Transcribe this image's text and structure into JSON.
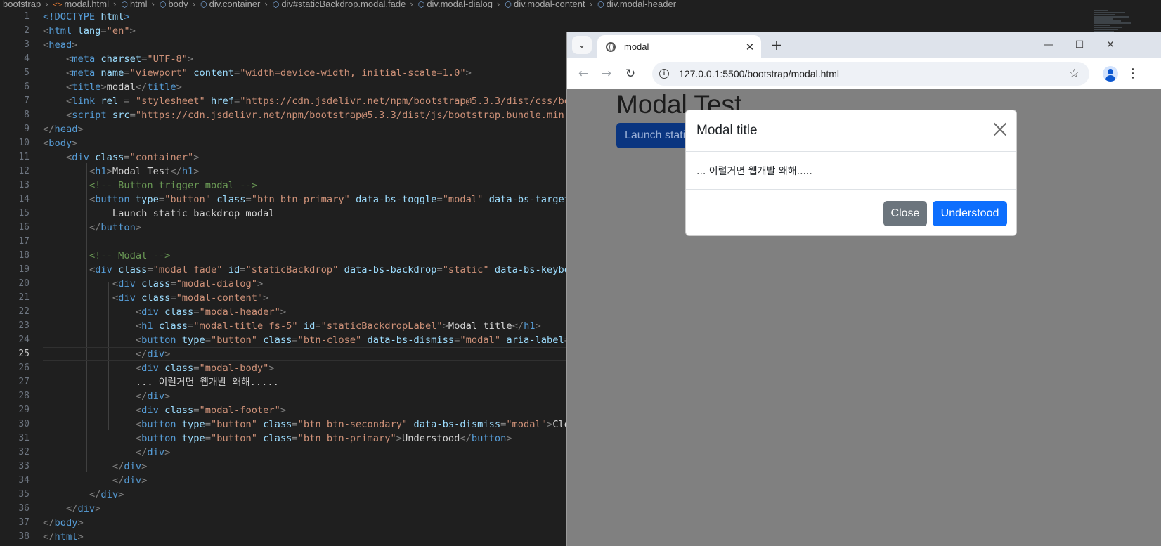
{
  "breadcrumb": [
    "bootstrap",
    "modal.html",
    "html",
    "body",
    "div.container",
    "div#staticBackdrop.modal.fade",
    "div.modal-dialog",
    "div.modal-content",
    "div.modal-header"
  ],
  "editor": {
    "active_line": 25,
    "line_numbers": [
      "1",
      "2",
      "3",
      "4",
      "5",
      "6",
      "7",
      "8",
      "9",
      "10",
      "11",
      "12",
      "13",
      "14",
      "15",
      "16",
      "17",
      "18",
      "19",
      "20",
      "21",
      "22",
      "23",
      "24",
      "25",
      "26",
      "27",
      "28",
      "29",
      "30",
      "31",
      "32",
      "33",
      "34",
      "35",
      "36",
      "37",
      "38"
    ],
    "lines": [
      [
        [
          "tag",
          "<!DOCTYPE "
        ],
        [
          "att",
          "html"
        ],
        [
          "tag",
          ">"
        ]
      ],
      [
        [
          "pun",
          "<"
        ],
        [
          "tag",
          "html "
        ],
        [
          "att",
          "lang"
        ],
        [
          "pun",
          "="
        ],
        [
          "str",
          "\"en\""
        ],
        [
          "pun",
          ">"
        ]
      ],
      [
        [
          "pun",
          "<"
        ],
        [
          "tag",
          "head"
        ],
        [
          "pun",
          ">"
        ]
      ],
      [
        [
          "txt",
          "    "
        ],
        [
          "pun",
          "<"
        ],
        [
          "tag",
          "meta "
        ],
        [
          "att",
          "charset"
        ],
        [
          "pun",
          "="
        ],
        [
          "str",
          "\"UTF-8\""
        ],
        [
          "pun",
          ">"
        ]
      ],
      [
        [
          "txt",
          "    "
        ],
        [
          "pun",
          "<"
        ],
        [
          "tag",
          "meta "
        ],
        [
          "att",
          "name"
        ],
        [
          "pun",
          "="
        ],
        [
          "str",
          "\"viewport\" "
        ],
        [
          "att",
          "content"
        ],
        [
          "pun",
          "="
        ],
        [
          "str",
          "\"width=device-width, initial-scale=1.0\""
        ],
        [
          "pun",
          ">"
        ]
      ],
      [
        [
          "txt",
          "    "
        ],
        [
          "pun",
          "<"
        ],
        [
          "tag",
          "title"
        ],
        [
          "pun",
          ">"
        ],
        [
          "txt",
          "modal"
        ],
        [
          "pun",
          "</"
        ],
        [
          "tag",
          "title"
        ],
        [
          "pun",
          ">"
        ]
      ],
      [
        [
          "txt",
          "    "
        ],
        [
          "pun",
          "<"
        ],
        [
          "tag",
          "link "
        ],
        [
          "att",
          "rel "
        ],
        [
          "pun",
          "= "
        ],
        [
          "str",
          "\"stylesheet\" "
        ],
        [
          "att",
          "href"
        ],
        [
          "pun",
          "="
        ],
        [
          "str",
          "\""
        ],
        [
          "url",
          "https://cdn.jsdelivr.net/npm/bootstrap@5.3.3/dist/css/bo"
        ]
      ],
      [
        [
          "txt",
          "    "
        ],
        [
          "pun",
          "<"
        ],
        [
          "tag",
          "script "
        ],
        [
          "att",
          "src"
        ],
        [
          "pun",
          "="
        ],
        [
          "str",
          "\""
        ],
        [
          "url",
          "https://cdn.jsdelivr.net/npm/bootstrap@5.3.3/dist/js/bootstrap.bundle.min."
        ]
      ],
      [
        [
          "pun",
          "</"
        ],
        [
          "tag",
          "head"
        ],
        [
          "pun",
          ">"
        ]
      ],
      [
        [
          "pun",
          "<"
        ],
        [
          "tag",
          "body"
        ],
        [
          "pun",
          ">"
        ]
      ],
      [
        [
          "txt",
          "    "
        ],
        [
          "pun",
          "<"
        ],
        [
          "tag",
          "div "
        ],
        [
          "att",
          "class"
        ],
        [
          "pun",
          "="
        ],
        [
          "str",
          "\"container\""
        ],
        [
          "pun",
          ">"
        ]
      ],
      [
        [
          "txt",
          "        "
        ],
        [
          "pun",
          "<"
        ],
        [
          "tag",
          "h1"
        ],
        [
          "pun",
          ">"
        ],
        [
          "txt",
          "Modal Test"
        ],
        [
          "pun",
          "</"
        ],
        [
          "tag",
          "h1"
        ],
        [
          "pun",
          ">"
        ]
      ],
      [
        [
          "txt",
          "        "
        ],
        [
          "com",
          "<!-- Button trigger modal -->"
        ]
      ],
      [
        [
          "txt",
          "        "
        ],
        [
          "pun",
          "<"
        ],
        [
          "tag",
          "button "
        ],
        [
          "att",
          "type"
        ],
        [
          "pun",
          "="
        ],
        [
          "str",
          "\"button\" "
        ],
        [
          "att",
          "class"
        ],
        [
          "pun",
          "="
        ],
        [
          "str",
          "\"btn btn-primary\" "
        ],
        [
          "att",
          "data-bs-toggle"
        ],
        [
          "pun",
          "="
        ],
        [
          "str",
          "\"modal\" "
        ],
        [
          "att",
          "data-bs-target"
        ]
      ],
      [
        [
          "txt",
          "            Launch static backdrop modal"
        ]
      ],
      [
        [
          "txt",
          "        "
        ],
        [
          "pun",
          "</"
        ],
        [
          "tag",
          "button"
        ],
        [
          "pun",
          ">"
        ]
      ],
      [
        [
          "txt",
          ""
        ]
      ],
      [
        [
          "txt",
          "        "
        ],
        [
          "com",
          "<!-- Modal -->"
        ]
      ],
      [
        [
          "txt",
          "        "
        ],
        [
          "pun",
          "<"
        ],
        [
          "tag",
          "div "
        ],
        [
          "att",
          "class"
        ],
        [
          "pun",
          "="
        ],
        [
          "str",
          "\"modal fade\" "
        ],
        [
          "att",
          "id"
        ],
        [
          "pun",
          "="
        ],
        [
          "str",
          "\"staticBackdrop\" "
        ],
        [
          "att",
          "data-bs-backdrop"
        ],
        [
          "pun",
          "="
        ],
        [
          "str",
          "\"static\" "
        ],
        [
          "att",
          "data-bs-keybo"
        ]
      ],
      [
        [
          "txt",
          "            "
        ],
        [
          "pun",
          "<"
        ],
        [
          "tag",
          "div "
        ],
        [
          "att",
          "class"
        ],
        [
          "pun",
          "="
        ],
        [
          "str",
          "\"modal-dialog\""
        ],
        [
          "pun",
          ">"
        ]
      ],
      [
        [
          "txt",
          "            "
        ],
        [
          "pun",
          "<"
        ],
        [
          "tag",
          "div "
        ],
        [
          "att",
          "class"
        ],
        [
          "pun",
          "="
        ],
        [
          "str",
          "\"modal-content\""
        ],
        [
          "pun",
          ">"
        ]
      ],
      [
        [
          "txt",
          "                "
        ],
        [
          "pun",
          "<"
        ],
        [
          "tag",
          "div "
        ],
        [
          "att",
          "class"
        ],
        [
          "pun",
          "="
        ],
        [
          "str",
          "\"modal-header\""
        ],
        [
          "pun",
          ">"
        ]
      ],
      [
        [
          "txt",
          "                "
        ],
        [
          "pun",
          "<"
        ],
        [
          "tag",
          "h1 "
        ],
        [
          "att",
          "class"
        ],
        [
          "pun",
          "="
        ],
        [
          "str",
          "\"modal-title fs-5\" "
        ],
        [
          "att",
          "id"
        ],
        [
          "pun",
          "="
        ],
        [
          "str",
          "\"staticBackdropLabel\""
        ],
        [
          "pun",
          ">"
        ],
        [
          "txt",
          "Modal title"
        ],
        [
          "pun",
          "</"
        ],
        [
          "tag",
          "h1"
        ],
        [
          "pun",
          ">"
        ]
      ],
      [
        [
          "txt",
          "                "
        ],
        [
          "pun",
          "<"
        ],
        [
          "tag",
          "button "
        ],
        [
          "att",
          "type"
        ],
        [
          "pun",
          "="
        ],
        [
          "str",
          "\"button\" "
        ],
        [
          "att",
          "class"
        ],
        [
          "pun",
          "="
        ],
        [
          "str",
          "\"btn-close\" "
        ],
        [
          "att",
          "data-bs-dismiss"
        ],
        [
          "pun",
          "="
        ],
        [
          "str",
          "\"modal\" "
        ],
        [
          "att",
          "aria-label"
        ],
        [
          "pun",
          "="
        ]
      ],
      [
        [
          "txt",
          "                "
        ],
        [
          "pun",
          "</"
        ],
        [
          "tag",
          "div"
        ],
        [
          "pun",
          ">"
        ]
      ],
      [
        [
          "txt",
          "                "
        ],
        [
          "pun",
          "<"
        ],
        [
          "tag",
          "div "
        ],
        [
          "att",
          "class"
        ],
        [
          "pun",
          "="
        ],
        [
          "str",
          "\"modal-body\""
        ],
        [
          "pun",
          ">"
        ]
      ],
      [
        [
          "txt",
          "                ... 이럴거면 웹개발 왜해....."
        ]
      ],
      [
        [
          "txt",
          "                "
        ],
        [
          "pun",
          "</"
        ],
        [
          "tag",
          "div"
        ],
        [
          "pun",
          ">"
        ]
      ],
      [
        [
          "txt",
          "                "
        ],
        [
          "pun",
          "<"
        ],
        [
          "tag",
          "div "
        ],
        [
          "att",
          "class"
        ],
        [
          "pun",
          "="
        ],
        [
          "str",
          "\"modal-footer\""
        ],
        [
          "pun",
          ">"
        ]
      ],
      [
        [
          "txt",
          "                "
        ],
        [
          "pun",
          "<"
        ],
        [
          "tag",
          "button "
        ],
        [
          "att",
          "type"
        ],
        [
          "pun",
          "="
        ],
        [
          "str",
          "\"button\" "
        ],
        [
          "att",
          "class"
        ],
        [
          "pun",
          "="
        ],
        [
          "str",
          "\"btn btn-secondary\" "
        ],
        [
          "att",
          "data-bs-dismiss"
        ],
        [
          "pun",
          "="
        ],
        [
          "str",
          "\"modal\""
        ],
        [
          "pun",
          ">"
        ],
        [
          "txt",
          "Clo"
        ]
      ],
      [
        [
          "txt",
          "                "
        ],
        [
          "pun",
          "<"
        ],
        [
          "tag",
          "button "
        ],
        [
          "att",
          "type"
        ],
        [
          "pun",
          "="
        ],
        [
          "str",
          "\"button\" "
        ],
        [
          "att",
          "class"
        ],
        [
          "pun",
          "="
        ],
        [
          "str",
          "\"btn btn-primary\""
        ],
        [
          "pun",
          ">"
        ],
        [
          "txt",
          "Understood"
        ],
        [
          "pun",
          "</"
        ],
        [
          "tag",
          "button"
        ],
        [
          "pun",
          ">"
        ]
      ],
      [
        [
          "txt",
          "                "
        ],
        [
          "pun",
          "</"
        ],
        [
          "tag",
          "div"
        ],
        [
          "pun",
          ">"
        ]
      ],
      [
        [
          "txt",
          "            "
        ],
        [
          "pun",
          "</"
        ],
        [
          "tag",
          "div"
        ],
        [
          "pun",
          ">"
        ]
      ],
      [
        [
          "txt",
          "            "
        ],
        [
          "pun",
          "</"
        ],
        [
          "tag",
          "div"
        ],
        [
          "pun",
          ">"
        ]
      ],
      [
        [
          "txt",
          "        "
        ],
        [
          "pun",
          "</"
        ],
        [
          "tag",
          "div"
        ],
        [
          "pun",
          ">"
        ]
      ],
      [
        [
          "txt",
          "    "
        ],
        [
          "pun",
          "</"
        ],
        [
          "tag",
          "div"
        ],
        [
          "pun",
          ">"
        ]
      ],
      [
        [
          "pun",
          "</"
        ],
        [
          "tag",
          "body"
        ],
        [
          "pun",
          ">"
        ]
      ],
      [
        [
          "pun",
          "</"
        ],
        [
          "tag",
          "html"
        ],
        [
          "pun",
          ">"
        ]
      ]
    ]
  },
  "browser": {
    "tab_title": "modal",
    "url": "127.0.0.1:5500/bootstrap/modal.html",
    "page": {
      "heading": "Modal Test",
      "launch_button_label": "Launch static backdrop modal"
    },
    "modal": {
      "title": "Modal title",
      "body": "... 이럴거면 웹개발 왜해.....",
      "close_label": "Close",
      "understood_label": "Understood"
    }
  },
  "colors": {
    "editor_bg": "#1f1f1f",
    "backdrop": "#808080",
    "primary": "#0d6efd",
    "secondary": "#6c757d"
  }
}
